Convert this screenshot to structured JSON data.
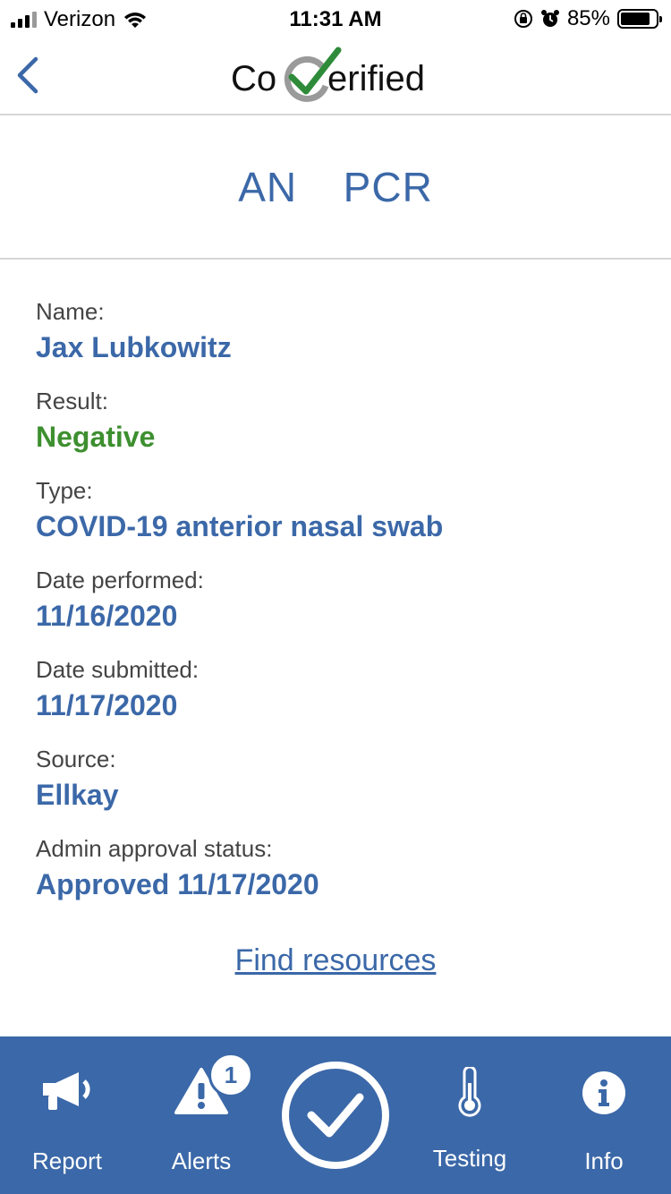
{
  "status_bar": {
    "carrier": "Verizon",
    "time": "11:31 AM",
    "battery_percent": "85%",
    "battery_level": 0.85
  },
  "nav": {
    "logo_left": "Co",
    "logo_right": "erified"
  },
  "page": {
    "title": "AN  PCR"
  },
  "fields": [
    {
      "label": "Name:",
      "value": "Jax Lubkowitz"
    },
    {
      "label": "Result:",
      "value": "Negative"
    },
    {
      "label": "Type:",
      "value": "COVID-19 anterior nasal swab"
    },
    {
      "label": "Date performed:",
      "value": "11/16/2020"
    },
    {
      "label": "Date submitted:",
      "value": "11/17/2020"
    },
    {
      "label": "Source:",
      "value": "Ellkay"
    },
    {
      "label": "Admin approval status:",
      "value": "Approved 11/17/2020"
    }
  ],
  "find_resources": "Find resources",
  "tabs": {
    "report": "Report",
    "alerts": "Alerts",
    "alerts_badge": "1",
    "testing": "Testing",
    "info": "Info"
  },
  "colors": {
    "accent": "#3b68a8",
    "negative": "#3d8f2f",
    "logo_check": "#2e8b3a"
  }
}
